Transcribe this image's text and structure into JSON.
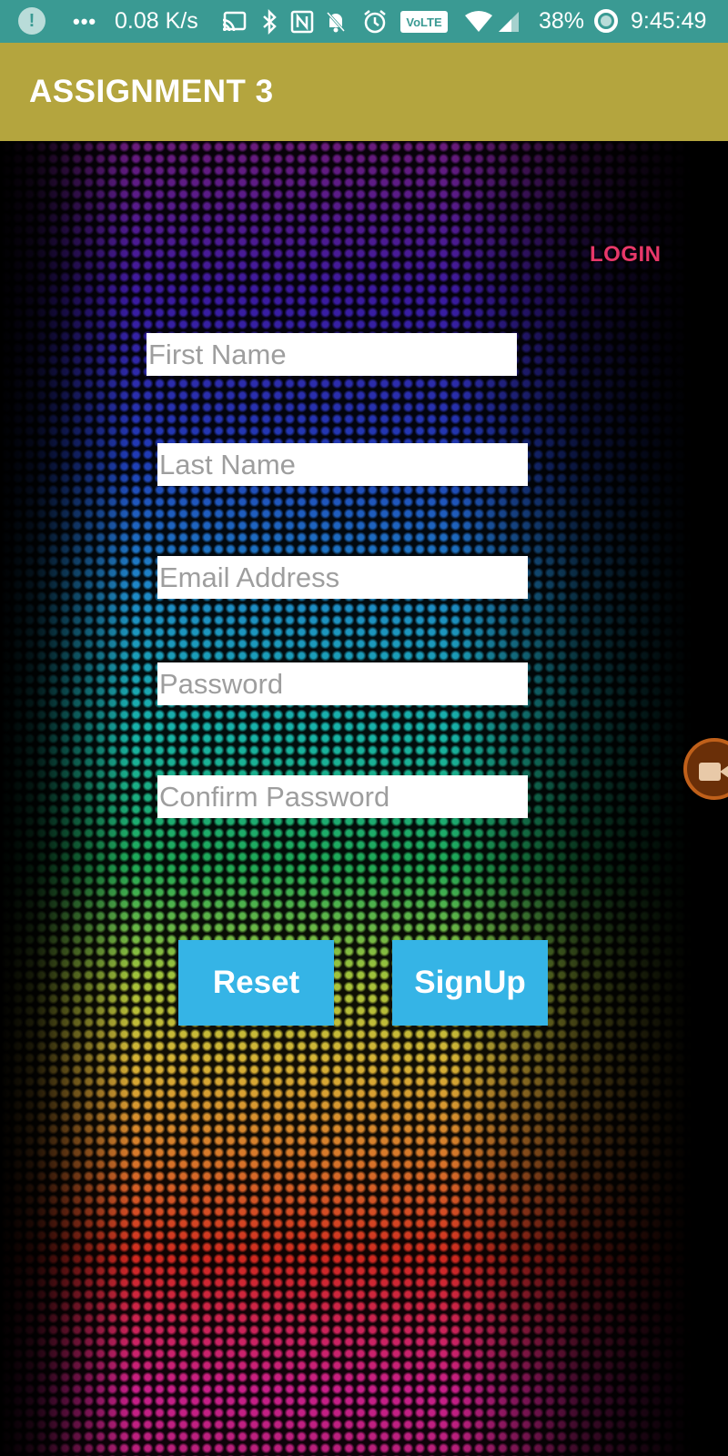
{
  "status_bar": {
    "alert_icon": "alert-icon",
    "dots": "•••",
    "network_speed": "0.08 K/s",
    "icons": [
      "cast-icon",
      "bluetooth-icon",
      "nfc-icon",
      "bell-off-icon",
      "alarm-icon",
      "volte-icon",
      "wifi-icon",
      "signal-icon"
    ],
    "volte_label": "VoLTE",
    "battery_percent": "38%",
    "time": "9:45:49"
  },
  "app_bar": {
    "title": "ASSIGNMENT 3",
    "color": "#b4a53e"
  },
  "login_link": {
    "label": "LOGIN",
    "color": "#e8386a"
  },
  "form": {
    "first_name": {
      "value": "",
      "placeholder": "First Name"
    },
    "last_name": {
      "value": "",
      "placeholder": "Last Name"
    },
    "email": {
      "value": "",
      "placeholder": "Email Address"
    },
    "password": {
      "value": "",
      "placeholder": "Password"
    },
    "confirm_password": {
      "value": "",
      "placeholder": "Confirm Password"
    }
  },
  "buttons": {
    "reset_label": "Reset",
    "signup_label": "SignUp",
    "color": "#35b4e6"
  },
  "floating": {
    "icon": "video-camera-icon"
  }
}
